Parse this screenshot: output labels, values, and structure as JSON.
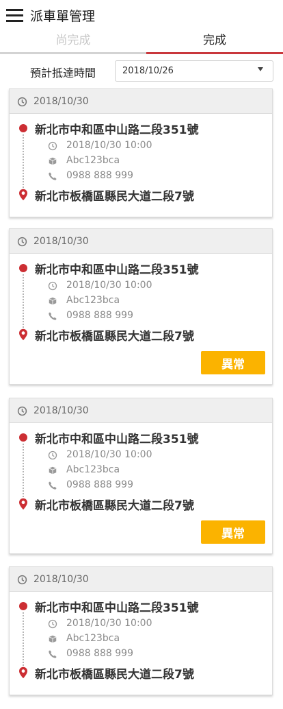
{
  "header": {
    "title": "派車單管理",
    "menu_icon": "hamburger-menu-icon"
  },
  "tabs": [
    {
      "label": "尚完成",
      "active": false
    },
    {
      "label": "完成",
      "active": true
    }
  ],
  "filter": {
    "label": "預計抵達時間",
    "value": "2018/10/26"
  },
  "colors": {
    "accent": "#c9373c",
    "origin_dot": "#cc2e33",
    "abnormal_button": "#fbb300",
    "inactive_tab": "#c8c8c8"
  },
  "cards": [
    {
      "date": "2018/10/30",
      "from": "新北市中和區中山路二段351號",
      "to": "新北市板橋區縣民大道二段7號",
      "time": "2018/10/30  10:00",
      "code": "Abc123bca",
      "phone": "0988 888 999"
    },
    {
      "date": "2018/10/30",
      "from": "新北市中和區中山路二段351號",
      "to": "新北市板橋區縣民大道二段7號",
      "time": "2018/10/30  10:00",
      "code": "Abc123bca",
      "phone": "0988 888 999",
      "action_label": "異常"
    },
    {
      "date": "2018/10/30",
      "from": "新北市中和區中山路二段351號",
      "to": "新北市板橋區縣民大道二段7號",
      "time": "2018/10/30  10:00",
      "code": "Abc123bca",
      "phone": "0988 888 999",
      "action_label": "異常"
    },
    {
      "date": "2018/10/30",
      "from": "新北市中和區中山路二段351號",
      "to": "新北市板橋區縣民大道二段7號",
      "time": "2018/10/30  10:00",
      "code": "Abc123bca",
      "phone": "0988 888 999"
    }
  ]
}
